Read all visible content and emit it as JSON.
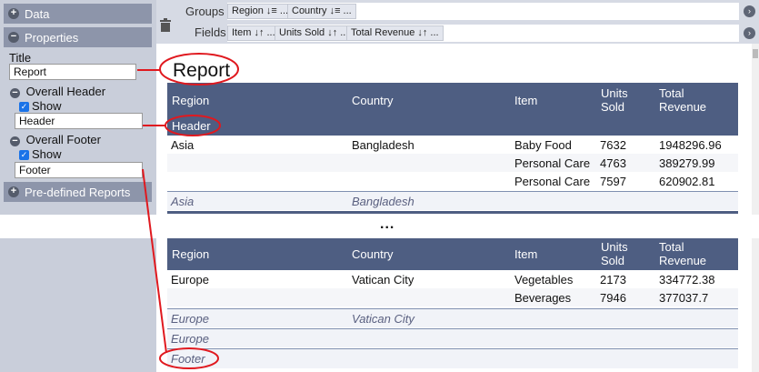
{
  "left_panel": {
    "data_section": "Data",
    "properties_section": "Properties",
    "title_label": "Title",
    "title_value": "Report",
    "overall_header": "Overall Header",
    "header_show": "Show",
    "header_value": "Header",
    "overall_footer": "Overall Footer",
    "footer_show": "Show",
    "footer_value": "Footer",
    "predefined_section": "Pre-defined Reports"
  },
  "toolbar": {
    "groups_label": "Groups",
    "fields_label": "Fields",
    "groups": [
      "Region ↓≡ ...",
      "Country ↓≡ ..."
    ],
    "fields": [
      "Item ↓↑ ...",
      "Units Sold ↓↑ ...",
      "Total Revenue ↓↑ ..."
    ]
  },
  "report": {
    "title": "Report",
    "header_text": "Header",
    "footer_text": "Footer",
    "ellipsis": "...",
    "columns": {
      "region": "Region",
      "country": "Country",
      "item": "Item",
      "units_line1": "Units",
      "units_line2": "Sold",
      "revenue_line1": "Total",
      "revenue_line2": "Revenue"
    },
    "top_rows": [
      {
        "region": "Asia",
        "country": "Bangladesh",
        "item": "Baby Food",
        "units": "7632",
        "revenue": "1948296.96"
      },
      {
        "region": "",
        "country": "",
        "item": "Personal Care",
        "units": "4763",
        "revenue": "389279.99"
      },
      {
        "region": "",
        "country": "",
        "item": "Personal Care",
        "units": "7597",
        "revenue": "620902.81"
      }
    ],
    "top_footer": {
      "region": "Asia",
      "country": "Bangladesh"
    },
    "bottom_rows": [
      {
        "region": "Europe",
        "country": "Vatican City",
        "item": "Vegetables",
        "units": "2173",
        "revenue": "334772.38"
      },
      {
        "region": "",
        "country": "",
        "item": "Beverages",
        "units": "7946",
        "revenue": "377037.7"
      }
    ],
    "bottom_country_footer": {
      "region": "Europe",
      "country": "Vatican City"
    },
    "bottom_region_footer": {
      "region": "Europe"
    }
  },
  "colors": {
    "header_band": "#4e5e82",
    "annotation": "#e0191f",
    "panel": "#c9ceda"
  }
}
